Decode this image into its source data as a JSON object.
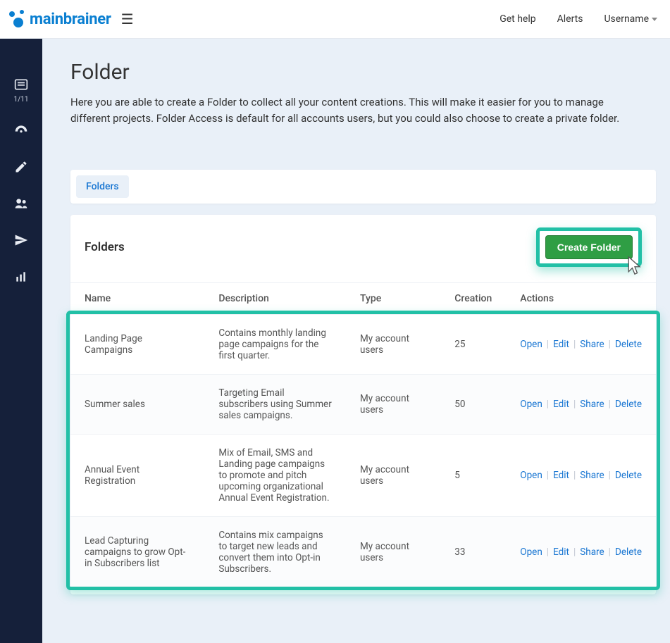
{
  "header": {
    "brand_main": "main",
    "brand_sub": "brainer",
    "get_help": "Get help",
    "alerts": "Alerts",
    "username": "Username"
  },
  "sidebar": {
    "step": "1/11"
  },
  "page": {
    "title": "Folder",
    "description": "Here you are able to create a Folder to collect all your content creations. This will make it easier for you to manage different projects. Folder Access is default for all accounts users, but you could also choose to create a private folder."
  },
  "tabs": {
    "folders": "Folders"
  },
  "panel": {
    "title": "Folders",
    "create_btn": "Create Folder"
  },
  "columns": {
    "name": "Name",
    "description": "Description",
    "type": "Type",
    "creation": "Creation",
    "actions": "Actions"
  },
  "actions": {
    "open": "Open",
    "edit": "Edit",
    "share": "Share",
    "delete": "Delete"
  },
  "rows": [
    {
      "name": "Landing Page Campaigns",
      "description": "Contains monthly landing page campaigns for the first quarter.",
      "type": "My account users",
      "creation": "25"
    },
    {
      "name": "Summer sales",
      "description": "Targeting Email subscribers using Summer sales campaigns.",
      "type": "My account users",
      "creation": "50"
    },
    {
      "name": "Annual Event Registration",
      "description": "Mix of Email, SMS and Landing page campaigns to promote and pitch upcoming organizational Annual Event Registration.",
      "type": "My account users",
      "creation": "5"
    },
    {
      "name": "Lead Capturing campaigns to grow Opt-in Subscribers list",
      "description": "Contains mix campaigns to target new leads and convert them into Opt-in Subscribers.",
      "type": "My account users",
      "creation": "33"
    }
  ]
}
